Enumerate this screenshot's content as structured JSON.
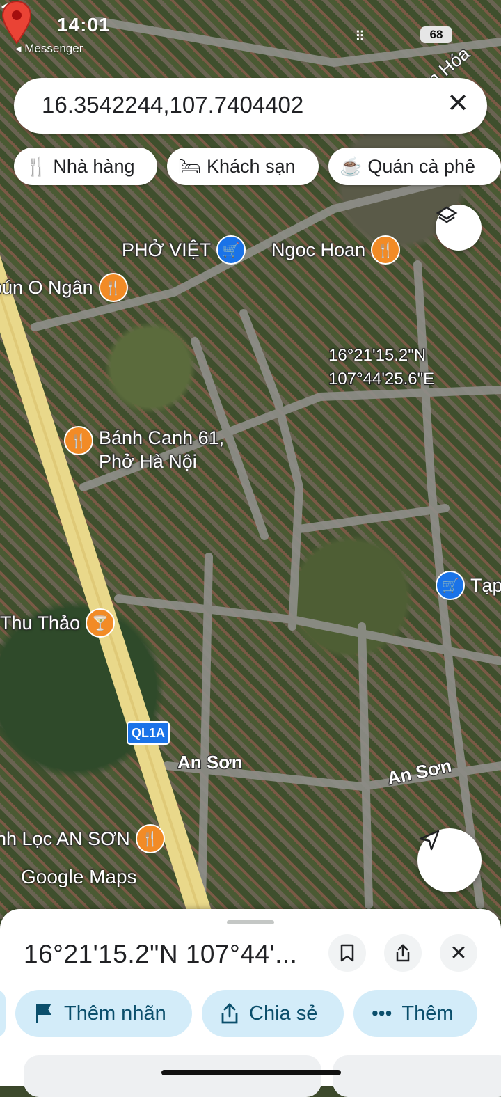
{
  "status_bar": {
    "time": "14:01",
    "back_label": "◂ Messenger",
    "battery": "68"
  },
  "search": {
    "query": "16.3542244,107.7404402"
  },
  "chips": [
    {
      "icon": "restaurant-icon",
      "label": "Nhà hàng"
    },
    {
      "icon": "hotel-icon",
      "label": "Khách sạn"
    },
    {
      "icon": "coffee-icon",
      "label": "Quán cà phê"
    }
  ],
  "map": {
    "top_right_label": "n Hóa",
    "pois": [
      {
        "label": "PHỞ VIỆT",
        "type": "shop"
      },
      {
        "label": "Ngoc Hoan",
        "type": "food"
      },
      {
        "label": "bún O Ngân",
        "type": "food"
      },
      {
        "label": "Bánh Canh 61,",
        "label2": "Phở Hà Nội",
        "type": "food"
      },
      {
        "label": "Tạp",
        "type": "shop"
      },
      {
        "label": "Thu Thảo",
        "type": "bar"
      },
      {
        "label": "nh Lọc AN SƠN",
        "type": "food"
      }
    ],
    "dropped_pin": {
      "lat": "16°21'15.2\"N",
      "lng": "107°44'25.6\"E"
    },
    "road_shield": "QL1A",
    "area_labels": [
      "An Sơn",
      "An Sơn"
    ],
    "watermark": "Google Maps"
  },
  "sheet": {
    "title": "16°21'15.2\"N 107°44'...",
    "actions": [
      {
        "icon": "flag-icon",
        "label": "Thêm nhãn"
      },
      {
        "icon": "share-icon",
        "label": "Chia sẻ"
      },
      {
        "icon": "more-icon",
        "label": "Thêm"
      }
    ]
  }
}
